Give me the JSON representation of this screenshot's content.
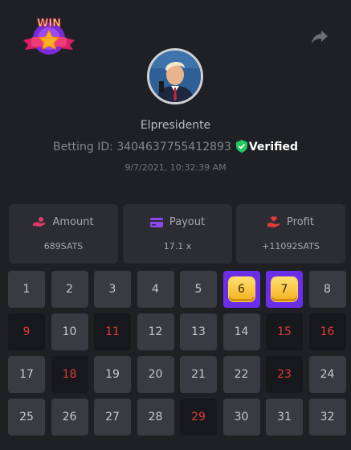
{
  "header": {
    "logo_text": "WIN"
  },
  "profile": {
    "username": "Elpresidente",
    "betting_label": "Betting ID:",
    "betting_id": "3404637755412893",
    "verified": "Verified",
    "date": "9/7/2021, 10:32:39 AM"
  },
  "stats": [
    {
      "label": "Amount",
      "value": "689SATS",
      "icon": "hand-coins-icon"
    },
    {
      "label": "Payout",
      "value": "17.1 x",
      "icon": "card-icon"
    },
    {
      "label": "Profit",
      "value": "+11092SATS",
      "icon": "hand-heart-icon"
    }
  ],
  "colors": {
    "accent": "#6a2ee8",
    "red_number": "#e13b3b",
    "verified_green": "#22c55e"
  },
  "grid": [
    {
      "n": "1",
      "s": "normal"
    },
    {
      "n": "2",
      "s": "normal"
    },
    {
      "n": "3",
      "s": "normal"
    },
    {
      "n": "4",
      "s": "normal"
    },
    {
      "n": "5",
      "s": "normal"
    },
    {
      "n": "6",
      "s": "selected"
    },
    {
      "n": "7",
      "s": "selected"
    },
    {
      "n": "8",
      "s": "normal"
    },
    {
      "n": "9",
      "s": "red"
    },
    {
      "n": "10",
      "s": "normal"
    },
    {
      "n": "11",
      "s": "red"
    },
    {
      "n": "12",
      "s": "normal"
    },
    {
      "n": "13",
      "s": "normal"
    },
    {
      "n": "14",
      "s": "normal"
    },
    {
      "n": "15",
      "s": "red"
    },
    {
      "n": "16",
      "s": "red"
    },
    {
      "n": "17",
      "s": "normal"
    },
    {
      "n": "18",
      "s": "red"
    },
    {
      "n": "19",
      "s": "normal"
    },
    {
      "n": "20",
      "s": "normal"
    },
    {
      "n": "21",
      "s": "normal"
    },
    {
      "n": "22",
      "s": "normal"
    },
    {
      "n": "23",
      "s": "red"
    },
    {
      "n": "24",
      "s": "normal"
    },
    {
      "n": "25",
      "s": "normal"
    },
    {
      "n": "26",
      "s": "normal"
    },
    {
      "n": "27",
      "s": "normal"
    },
    {
      "n": "28",
      "s": "normal"
    },
    {
      "n": "29",
      "s": "red"
    },
    {
      "n": "30",
      "s": "normal"
    },
    {
      "n": "31",
      "s": "normal"
    },
    {
      "n": "32",
      "s": "normal"
    }
  ]
}
